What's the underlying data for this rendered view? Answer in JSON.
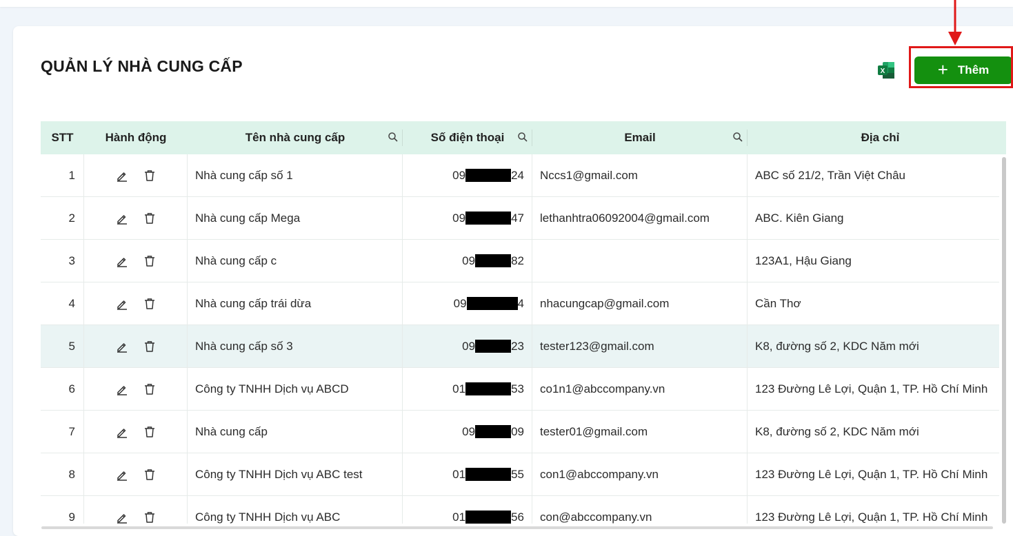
{
  "page": {
    "title": "QUẢN LÝ NHÀ CUNG CẤP"
  },
  "toolbar": {
    "excel_icon": "excel-icon",
    "add_label": "Thêm",
    "add_icon": "plus-icon",
    "accent_color": "#14900f",
    "highlight_color": "#e01818"
  },
  "table": {
    "columns": {
      "stt": "STT",
      "actions": "Hành động",
      "name": "Tên nhà cung cấp",
      "phone": "Số điện thoại",
      "email": "Email",
      "address": "Địa chỉ"
    },
    "header_color": "#ddf3ea",
    "rows": [
      {
        "stt": "1",
        "name": "Nhà cung cấp số 1",
        "phone_start": "09",
        "phone_end": "24",
        "email": "Nccs1@gmail.com",
        "address": "ABC số 21/2, Trần Việt Châu"
      },
      {
        "stt": "2",
        "name": "Nhà cung cấp Mega",
        "phone_start": "09",
        "phone_end": "47",
        "email": "lethanhtra06092004@gmail.com",
        "address": "ABC. Kiên Giang"
      },
      {
        "stt": "3",
        "name": "Nhà cung cấp c",
        "phone_start": "09",
        "phone_end": "82",
        "email": "",
        "address": "123A1, Hậu Giang"
      },
      {
        "stt": "4",
        "name": "Nhà cung cấp trái dừa",
        "phone_start": "09",
        "phone_end": "4",
        "email": "nhacungcap@gmail.com",
        "address": "Cần Thơ"
      },
      {
        "stt": "5",
        "name": "Nhà cung cấp số 3",
        "phone_start": "09",
        "phone_end": "23",
        "email": "tester123@gmail.com",
        "address": "K8, đường số 2, KDC Năm mới"
      },
      {
        "stt": "6",
        "name": "Công ty TNHH Dịch vụ ABCD",
        "phone_start": "01",
        "phone_end": "53",
        "email": "co1n1@abccompany.vn",
        "address": "123 Đường Lê Lợi, Quận 1, TP. Hồ Chí Minh"
      },
      {
        "stt": "7",
        "name": "Nhà cung cấp",
        "phone_start": "09",
        "phone_end": "09",
        "email": "tester01@gmail.com",
        "address": "K8, đường số 2, KDC Năm mới"
      },
      {
        "stt": "8",
        "name": "Công ty TNHH Dịch vụ ABC test",
        "phone_start": "01",
        "phone_end": "55",
        "email": "con1@abccompany.vn",
        "address": "123 Đường Lê Lợi, Quận 1, TP. Hồ Chí Minh"
      },
      {
        "stt": "9",
        "name": "Công ty TNHH Dịch vụ ABC",
        "phone_start": "01",
        "phone_end": "56",
        "email": "con@abccompany.vn",
        "address": "123 Đường Lê Lợi, Quận 1, TP. Hồ Chí Minh"
      }
    ]
  }
}
